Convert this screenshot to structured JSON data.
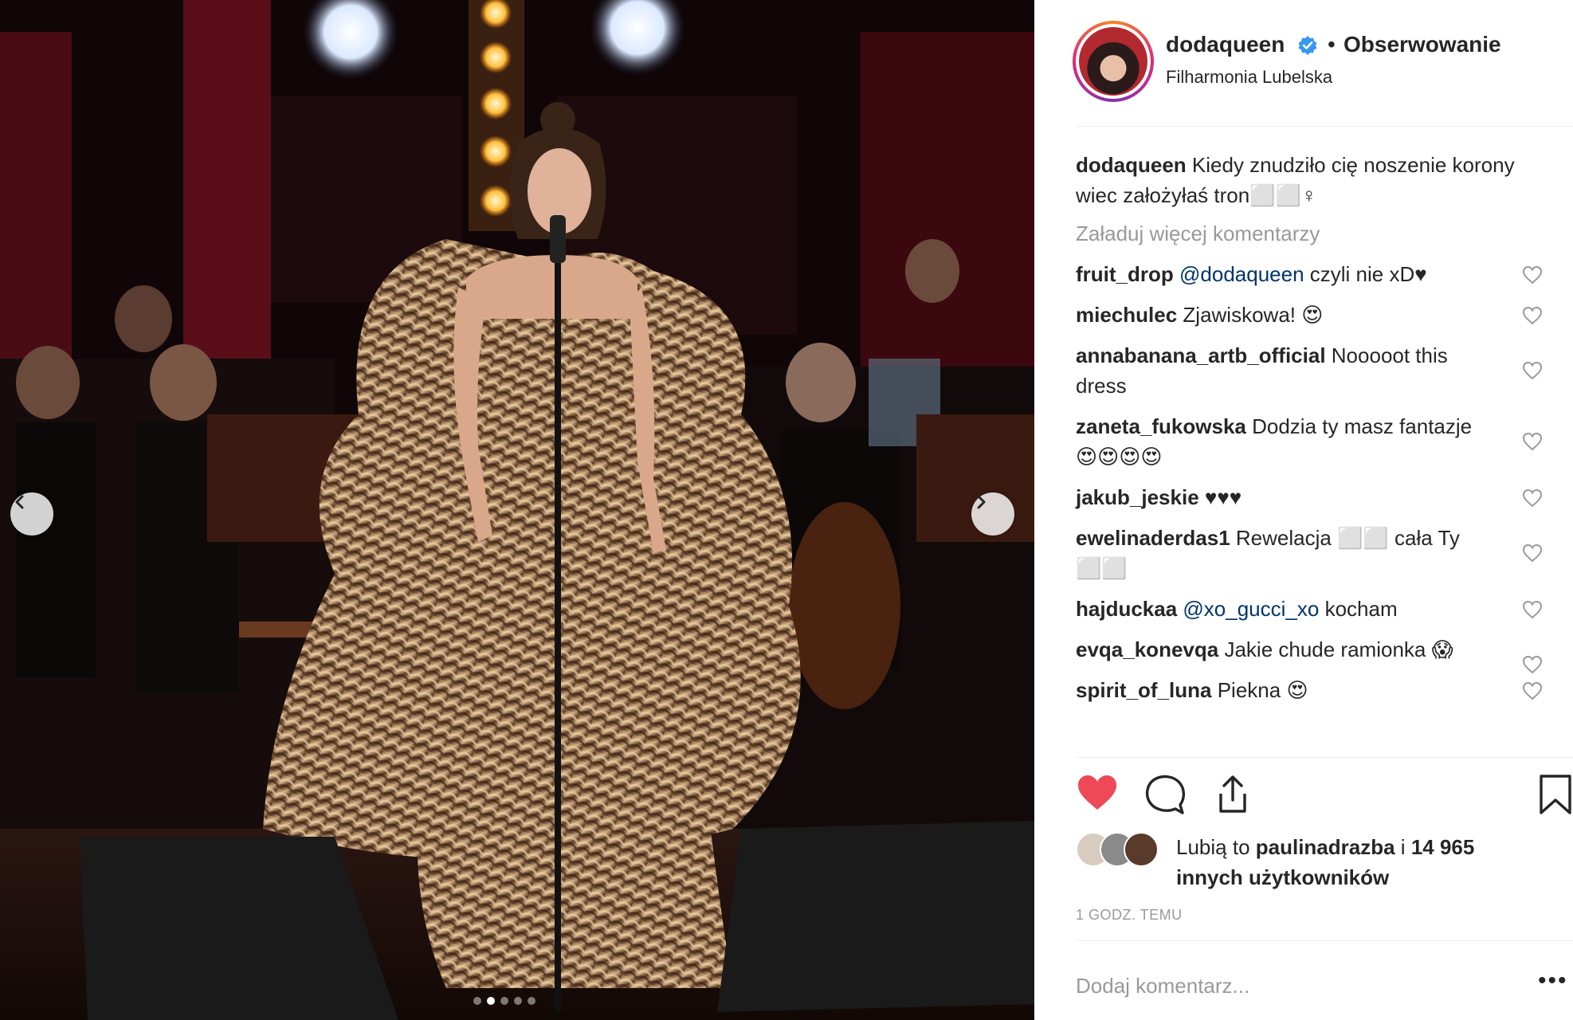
{
  "post": {
    "username": "dodaqueen",
    "follow_separator": "•",
    "follow_label": "Obserwowanie",
    "location": "Filharmonia Lubelska"
  },
  "caption": {
    "username": "dodaqueen",
    "text": "Kiedy znudziło cię noszenie korony wiec założyłaś tron⬜⬜♀"
  },
  "load_more": "Załaduj więcej komentarzy",
  "comments": [
    {
      "user": "fruit_drop",
      "mention": "@dodaqueen",
      "text": " czyli nie xD♥"
    },
    {
      "user": "miechulec",
      "mention": "",
      "text": "Zjawiskowa! 😍"
    },
    {
      "user": "annabanana_artb_official",
      "mention": "",
      "text": "Nooooot this dress"
    },
    {
      "user": "zaneta_fukowska",
      "mention": "",
      "text": "Dodzia ty masz fantazje😍😍😍😍"
    },
    {
      "user": "jakub_jeskie",
      "mention": "",
      "text": "♥♥♥"
    },
    {
      "user": "ewelinaderdas1",
      "mention": "",
      "text": "Rewelacja ⬜⬜ cała Ty ⬜⬜"
    },
    {
      "user": "hajduckaa",
      "mention": "@xo_gucci_xo",
      "text": " kocham"
    },
    {
      "user": "evqa_konevqa",
      "mention": "",
      "text": "Jakie chude ramionka 😱"
    },
    {
      "user": "spirit_of_luna",
      "mention": "",
      "text": "Piekna 😍"
    }
  ],
  "likes": {
    "prefix": "Lubią to ",
    "first_user": "paulinadrazba",
    "middle": " i ",
    "count": "14 965",
    "suffix": " innych użytkowników"
  },
  "timestamp": "1 GODZ. TEMU",
  "add_comment_placeholder": "Dodaj komentarz...",
  "more_options": "•••",
  "carousel": {
    "total": 5,
    "active": 1
  },
  "colors": {
    "like_red": "#ed4956",
    "verified_blue": "#3897f0",
    "mention_blue": "#003569",
    "muted_gray": "#999999",
    "text": "#262626"
  },
  "icons": [
    "chevron-left-icon",
    "chevron-right-icon",
    "verified-icon",
    "heart-icon",
    "comment-icon",
    "share-icon",
    "bookmark-icon",
    "heart-outline-icon"
  ]
}
